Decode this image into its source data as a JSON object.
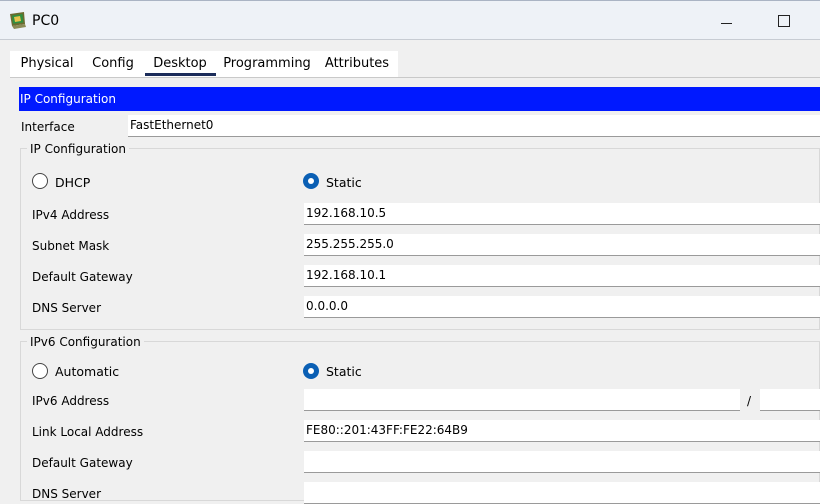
{
  "window": {
    "title": "PC0",
    "icon": "computer-icon",
    "minimize_icon": "minimize-icon",
    "maximize_icon": "maximize-icon"
  },
  "tabs": [
    "Physical",
    "Config",
    "Desktop",
    "Programming",
    "Attributes"
  ],
  "active_tab": "Desktop",
  "header": {
    "title": "IP Configuration"
  },
  "interface": {
    "label": "Interface",
    "value": "FastEthernet0"
  },
  "ipv4": {
    "group_title": "IP Configuration",
    "dhcp_label": "DHCP",
    "static_label": "Static",
    "selected_mode": "Static",
    "fields": [
      {
        "label": "IPv4 Address",
        "value": "192.168.10.5"
      },
      {
        "label": "Subnet Mask",
        "value": "255.255.255.0"
      },
      {
        "label": "Default Gateway",
        "value": "192.168.10.1"
      },
      {
        "label": "DNS Server",
        "value": "0.0.0.0"
      }
    ]
  },
  "ipv6": {
    "group_title": "IPv6 Configuration",
    "automatic_label": "Automatic",
    "static_label": "Static",
    "selected_mode": "Static",
    "address_label": "IPv6 Address",
    "address_value": "",
    "prefix_separator": "/",
    "prefix_value": "",
    "link_local_label": "Link Local Address",
    "link_local_value": "FE80::201:43FF:FE22:64B9",
    "gateway_label": "Default Gateway",
    "gateway_value": "",
    "dns_label": "DNS Server",
    "dns_value": ""
  },
  "colors": {
    "header_bg": "#0019ff",
    "radio_selected": "#0a5fb4",
    "tab_underline": "#1b2c5a"
  }
}
